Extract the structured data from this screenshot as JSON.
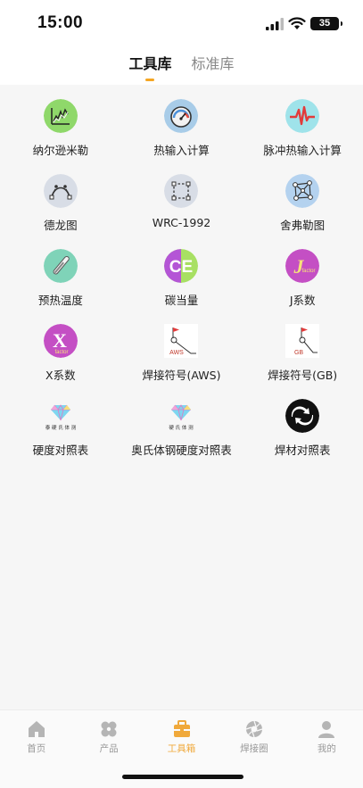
{
  "status": {
    "time": "15:00",
    "battery": "35"
  },
  "top_tabs": [
    {
      "label": "工具库",
      "active": true
    },
    {
      "label": "标准库",
      "active": false
    }
  ],
  "tools": [
    {
      "label": "纳尔逊米勒",
      "icon": "line-chart-icon"
    },
    {
      "label": "热输入计算",
      "icon": "gauge-icon"
    },
    {
      "label": "脉冲热输入计算",
      "icon": "pulse-icon"
    },
    {
      "label": "德龙图",
      "icon": "curve-icon"
    },
    {
      "label": "WRC-1992",
      "icon": "grid-nodes-icon"
    },
    {
      "label": "舍弗勒图",
      "icon": "network-icon"
    },
    {
      "label": "预热温度",
      "icon": "thermometer-icon"
    },
    {
      "label": "碳当量",
      "icon": "ce-icon",
      "text": "CE"
    },
    {
      "label": "J系数",
      "icon": "j-factor-icon",
      "text": "J",
      "subtext": "factor"
    },
    {
      "label": "X系数",
      "icon": "x-factor-icon",
      "text": "X",
      "subtext": "factor"
    },
    {
      "label": "焊接符号(AWS)",
      "icon": "weld-symbol-aws-icon",
      "text": "AWS"
    },
    {
      "label": "焊接符号(GB)",
      "icon": "weld-symbol-gb-icon",
      "text": "GB"
    },
    {
      "label": "硬度对照表",
      "icon": "diamond-icon",
      "text": "泰 硬 氏 体 测"
    },
    {
      "label": "奥氏体钢硬度对照表",
      "icon": "diamond-icon",
      "text": "硬 氏 体 测"
    },
    {
      "label": "焊材对照表",
      "icon": "exchange-icon"
    }
  ],
  "bottom_nav": [
    {
      "label": "首页",
      "icon": "home-icon",
      "active": false
    },
    {
      "label": "产品",
      "icon": "product-icon",
      "active": false
    },
    {
      "label": "工具箱",
      "icon": "toolbox-icon",
      "active": true
    },
    {
      "label": "焊接圈",
      "icon": "aperture-icon",
      "active": false
    },
    {
      "label": "我的",
      "icon": "user-icon",
      "active": false
    }
  ],
  "colors": {
    "accent": "#f0a93b",
    "background": "#f6f6f6"
  }
}
